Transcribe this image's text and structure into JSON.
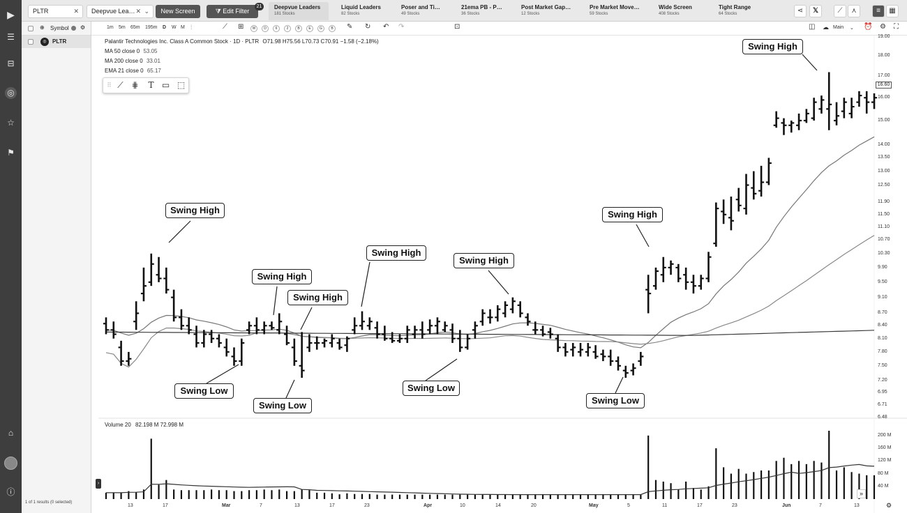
{
  "topbar": {
    "symbol_tab": "PLTR",
    "screen_tab": "Deepvue Lea…",
    "new_screen": "New Screen",
    "edit_filter": "Edit Filter",
    "filter_count": "21",
    "screens": [
      {
        "name": "Deepvue Leaders",
        "count": "181 Stocks"
      },
      {
        "name": "Liquid Leaders",
        "count": "82 Stocks"
      },
      {
        "name": "Poser and Ti…",
        "count": "49 Stocks"
      },
      {
        "name": "21ema PB - P…",
        "count": "36 Stocks"
      },
      {
        "name": "Post Market Gap…",
        "count": "12 Stocks"
      },
      {
        "name": "Pre Market Move…",
        "count": "59 Stocks"
      },
      {
        "name": "Wide Screen",
        "count": "408 Stocks"
      },
      {
        "name": "Tight Range",
        "count": "64 Stocks"
      }
    ]
  },
  "sidebar": {
    "header": "Symbol",
    "symbol": "PLTR",
    "results": "1 of 1 results (0 selected)"
  },
  "toolbar": {
    "timeframes": [
      "1m",
      "5m",
      "65m",
      "195m",
      "D",
      "W",
      "M"
    ],
    "chips": [
      "W",
      "D",
      "6",
      "2",
      "B",
      "E",
      "G",
      "B"
    ],
    "layout_label": "Main"
  },
  "chart": {
    "title": "Palantir Technologies Inc. Class A Common Stock · 1D · PLTR",
    "ohlc": "O71.98  H75.56  L70.73  C70.91  −1.58 (−2.18%)",
    "indicators": [
      {
        "label": "MA 50 close 0",
        "value": "53.05"
      },
      {
        "label": "MA 200 close 0",
        "value": "33.01"
      },
      {
        "label": "EMA 21 close 0",
        "value": "65.17"
      }
    ],
    "volume_label": "Volume 20",
    "volume_values": "82.198 M  72.998 M",
    "price_badge": "16.60",
    "price_ticks": [
      "19.00",
      "18.00",
      "17.00",
      "16.00",
      "15.00",
      "14.00",
      "13.50",
      "13.00",
      "12.50",
      "11.90",
      "11.50",
      "11.10",
      "10.70",
      "10.30",
      "9.90",
      "9.50",
      "9.10",
      "8.70",
      "8.40",
      "8.10",
      "7.80",
      "7.50",
      "7.20",
      "6.95",
      "6.71",
      "6.48"
    ],
    "volume_ticks": [
      "200 M",
      "160 M",
      "120 M",
      "80 M",
      "40 M"
    ],
    "date_ticks": [
      {
        "t": "13",
        "b": false
      },
      {
        "t": "17",
        "b": false
      },
      {
        "t": "Mar",
        "b": true
      },
      {
        "t": "7",
        "b": false
      },
      {
        "t": "13",
        "b": false
      },
      {
        "t": "17",
        "b": false
      },
      {
        "t": "23",
        "b": false
      },
      {
        "t": "Apr",
        "b": true
      },
      {
        "t": "10",
        "b": false
      },
      {
        "t": "14",
        "b": false
      },
      {
        "t": "20",
        "b": false
      },
      {
        "t": "May",
        "b": true
      },
      {
        "t": "5",
        "b": false
      },
      {
        "t": "11",
        "b": false
      },
      {
        "t": "17",
        "b": false
      },
      {
        "t": "23",
        "b": false
      },
      {
        "t": "Jun",
        "b": true
      },
      {
        "t": "7",
        "b": false
      },
      {
        "t": "13",
        "b": false
      }
    ],
    "annotations": [
      "Swing High",
      "Swing High",
      "Swing High",
      "Swing High",
      "Swing High",
      "Swing High",
      "Swing High",
      "Swing Low",
      "Swing Low",
      "Swing Low",
      "Swing Low"
    ]
  },
  "chart_data": {
    "type": "bar",
    "title": "Palantir Technologies Inc. Class A Common Stock · 1D · PLTR",
    "ohlc": [
      [
        8.45,
        8.6,
        8.2,
        8.3
      ],
      [
        8.3,
        8.5,
        8.1,
        8.2
      ],
      [
        7.9,
        8.05,
        7.5,
        7.6
      ],
      [
        7.6,
        7.8,
        7.5,
        7.65
      ],
      [
        8.5,
        9.0,
        8.3,
        8.7
      ],
      [
        9.2,
        9.9,
        9.0,
        9.4
      ],
      [
        9.5,
        10.3,
        9.4,
        10.0
      ],
      [
        9.7,
        10.2,
        9.5,
        9.6
      ],
      [
        9.6,
        9.9,
        9.2,
        9.3
      ],
      [
        9.1,
        9.3,
        8.5,
        8.6
      ],
      [
        8.6,
        8.8,
        8.3,
        8.4
      ],
      [
        8.4,
        8.6,
        8.2,
        8.3
      ],
      [
        8.2,
        8.4,
        7.9,
        8.0
      ],
      [
        8.0,
        8.3,
        7.9,
        8.2
      ],
      [
        8.2,
        8.3,
        8.0,
        8.1
      ],
      [
        8.1,
        8.2,
        7.9,
        8.0
      ],
      [
        7.9,
        8.1,
        7.7,
        7.8
      ],
      [
        7.7,
        7.9,
        7.5,
        7.6
      ],
      [
        7.6,
        8.1,
        7.5,
        8.0
      ],
      [
        8.3,
        8.5,
        8.2,
        8.4
      ],
      [
        8.4,
        8.6,
        8.2,
        8.3
      ],
      [
        8.3,
        8.5,
        8.2,
        8.4
      ],
      [
        8.4,
        8.5,
        8.3,
        8.35
      ],
      [
        8.3,
        8.7,
        8.2,
        8.5
      ],
      [
        8.2,
        8.4,
        7.95,
        8.0
      ],
      [
        7.9,
        8.1,
        7.5,
        7.6
      ],
      [
        7.5,
        8.25,
        7.25,
        7.4
      ],
      [
        7.9,
        8.2,
        7.8,
        8.0
      ],
      [
        8.0,
        8.15,
        7.85,
        8.0
      ],
      [
        8.0,
        8.1,
        7.9,
        8.05
      ],
      [
        8.0,
        8.2,
        7.9,
        8.1
      ],
      [
        8.0,
        8.1,
        7.85,
        7.9
      ],
      [
        7.95,
        8.15,
        7.8,
        8.1
      ],
      [
        8.3,
        8.6,
        8.2,
        8.4
      ],
      [
        8.4,
        8.75,
        8.3,
        8.5
      ],
      [
        8.4,
        8.6,
        8.3,
        8.5
      ],
      [
        8.35,
        8.5,
        8.1,
        8.2
      ],
      [
        8.2,
        8.4,
        8.05,
        8.1
      ],
      [
        8.1,
        8.25,
        8.0,
        8.05
      ],
      [
        8.05,
        8.2,
        8.0,
        8.1
      ],
      [
        8.1,
        8.4,
        8.0,
        8.3
      ],
      [
        8.2,
        8.4,
        8.1,
        8.3
      ],
      [
        8.3,
        8.5,
        8.1,
        8.2
      ],
      [
        8.3,
        8.55,
        8.2,
        8.4
      ],
      [
        8.4,
        8.6,
        8.2,
        8.5
      ],
      [
        8.3,
        8.5,
        8.25,
        8.4
      ],
      [
        8.3,
        8.45,
        8.0,
        8.1
      ],
      [
        8.1,
        8.3,
        7.8,
        7.9
      ],
      [
        7.9,
        8.2,
        7.85,
        8.1
      ],
      [
        8.3,
        8.5,
        8.1,
        8.4
      ],
      [
        8.5,
        8.8,
        8.4,
        8.7
      ],
      [
        8.6,
        8.8,
        8.45,
        8.6
      ],
      [
        8.6,
        8.9,
        8.5,
        8.8
      ],
      [
        8.7,
        9.0,
        8.6,
        8.9
      ],
      [
        8.8,
        9.1,
        8.7,
        9.0
      ],
      [
        8.9,
        9.0,
        8.6,
        8.7
      ],
      [
        8.6,
        8.7,
        8.4,
        8.5
      ],
      [
        8.3,
        8.5,
        8.2,
        8.3
      ],
      [
        8.3,
        8.4,
        8.15,
        8.2
      ],
      [
        8.25,
        8.35,
        8.1,
        8.2
      ],
      [
        8.1,
        8.2,
        7.8,
        7.9
      ],
      [
        7.9,
        8.0,
        7.7,
        7.8
      ],
      [
        7.85,
        8.0,
        7.7,
        7.9
      ],
      [
        7.8,
        8.0,
        7.7,
        7.85
      ],
      [
        7.8,
        8.0,
        7.7,
        7.9
      ],
      [
        7.8,
        7.95,
        7.65,
        7.7
      ],
      [
        7.75,
        7.85,
        7.6,
        7.7
      ],
      [
        7.7,
        7.85,
        7.5,
        7.6
      ],
      [
        7.6,
        7.7,
        7.4,
        7.5
      ],
      [
        7.4,
        7.5,
        7.25,
        7.35
      ],
      [
        7.4,
        7.55,
        7.3,
        7.45
      ],
      [
        7.6,
        7.8,
        7.5,
        7.7
      ],
      [
        9.3,
        9.7,
        8.7,
        9.2
      ],
      [
        9.4,
        9.9,
        9.3,
        9.8
      ],
      [
        9.7,
        10.2,
        9.5,
        9.9
      ],
      [
        9.9,
        10.1,
        9.7,
        10.0
      ],
      [
        9.9,
        10.0,
        9.5,
        9.6
      ],
      [
        9.7,
        9.9,
        9.3,
        9.5
      ],
      [
        9.5,
        9.7,
        9.2,
        9.4
      ],
      [
        9.4,
        9.7,
        9.3,
        9.6
      ],
      [
        9.6,
        10.35,
        9.5,
        10.2
      ],
      [
        10.6,
        11.9,
        10.5,
        11.7
      ],
      [
        11.6,
        12.0,
        11.2,
        11.5
      ],
      [
        11.4,
        12.1,
        11.0,
        11.3
      ],
      [
        12.0,
        12.4,
        11.6,
        11.8
      ],
      [
        11.7,
        12.9,
        11.5,
        12.5
      ],
      [
        12.4,
        13.0,
        12.0,
        12.2
      ],
      [
        12.3,
        13.2,
        12.1,
        12.6
      ],
      [
        12.6,
        13.5,
        12.5,
        13.3
      ],
      [
        14.8,
        15.4,
        14.7,
        15.1
      ],
      [
        14.9,
        15.1,
        14.4,
        14.8
      ],
      [
        14.8,
        15.0,
        14.5,
        14.9
      ],
      [
        14.8,
        15.3,
        14.6,
        15.0
      ],
      [
        15.0,
        15.5,
        14.9,
        15.3
      ],
      [
        15.1,
        16.0,
        15.0,
        15.8
      ],
      [
        15.5,
        16.1,
        15.3,
        15.9
      ],
      [
        15.5,
        17.2,
        14.6,
        15.7
      ],
      [
        15.0,
        15.8,
        14.8,
        15.2
      ],
      [
        15.4,
        16.0,
        15.1,
        15.8
      ],
      [
        15.3,
        16.0,
        15.1,
        15.6
      ],
      [
        15.8,
        16.3,
        15.6,
        16.1
      ],
      [
        16.0,
        16.3,
        15.3,
        15.8
      ],
      [
        15.8,
        16.2,
        15.5,
        16.0
      ]
    ],
    "volume_millions": [
      20,
      20,
      20,
      25,
      22,
      30,
      190,
      45,
      60,
      30,
      28,
      28,
      28,
      28,
      30,
      28,
      28,
      25,
      25,
      28,
      28,
      30,
      28,
      30,
      25,
      25,
      30,
      28,
      20,
      20,
      18,
      15,
      18,
      16,
      16,
      16,
      14,
      14,
      14,
      14,
      14,
      14,
      14,
      14,
      14,
      14,
      14,
      14,
      14,
      14,
      14,
      14,
      14,
      14,
      14,
      14,
      14,
      14,
      14,
      14,
      14,
      14,
      14,
      14,
      14,
      14,
      14,
      14,
      14,
      14,
      14,
      14,
      200,
      60,
      55,
      50,
      30,
      55,
      35,
      30,
      40,
      160,
      100,
      80,
      95,
      80,
      85,
      90,
      90,
      120,
      130,
      110,
      120,
      110,
      120,
      115,
      215,
      90,
      100,
      85,
      80,
      75,
      75
    ],
    "series": [
      {
        "name": "MA 50 close 0",
        "color": "#888888"
      },
      {
        "name": "MA 200 close 0",
        "color": "#3a3a3a"
      },
      {
        "name": "EMA 21 close 0",
        "color": "#777777"
      },
      {
        "name": "Volume 20",
        "color": "#333333"
      }
    ],
    "ylabel": "",
    "xlabel": "",
    "y_scale": "log",
    "ylim": [
      6.48,
      19.0
    ]
  }
}
